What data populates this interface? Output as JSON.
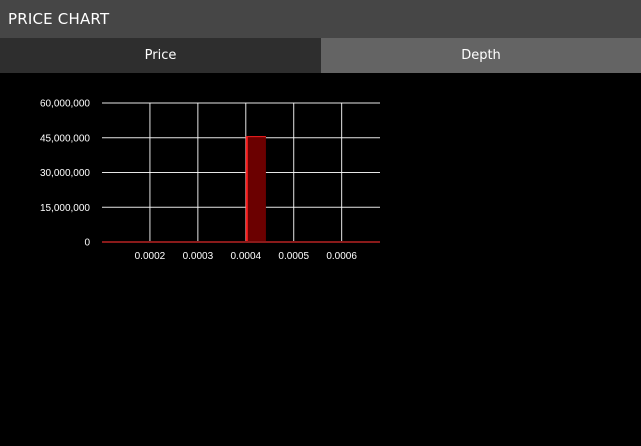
{
  "header": {
    "title": "PRICE CHART"
  },
  "tabs": [
    {
      "label": "Price",
      "active": true
    },
    {
      "label": "Depth",
      "active": false
    }
  ],
  "colors": {
    "header_bg": "#464646",
    "tab_active_bg": "#2e2e2e",
    "tab_inactive_bg": "#646464",
    "grid": "#ffffff",
    "bar_fill": "#6b0000",
    "bar_edge": "#ff2020",
    "baseline": "#8a1a1a"
  },
  "chart_data": {
    "type": "bar",
    "x_ticks": [
      "0.0002",
      "0.0003",
      "0.0004",
      "0.0005",
      "0.0006"
    ],
    "y_ticks": [
      "60,000,000",
      "45,000,000",
      "30,000,000",
      "15,000,000",
      "0"
    ],
    "xlim": [
      0.0001,
      0.00068
    ],
    "ylim": [
      0,
      60000000
    ],
    "grid": true,
    "bars": [
      {
        "x_start": 0.0004,
        "x_end": 0.000442,
        "value": 45500000
      }
    ]
  }
}
